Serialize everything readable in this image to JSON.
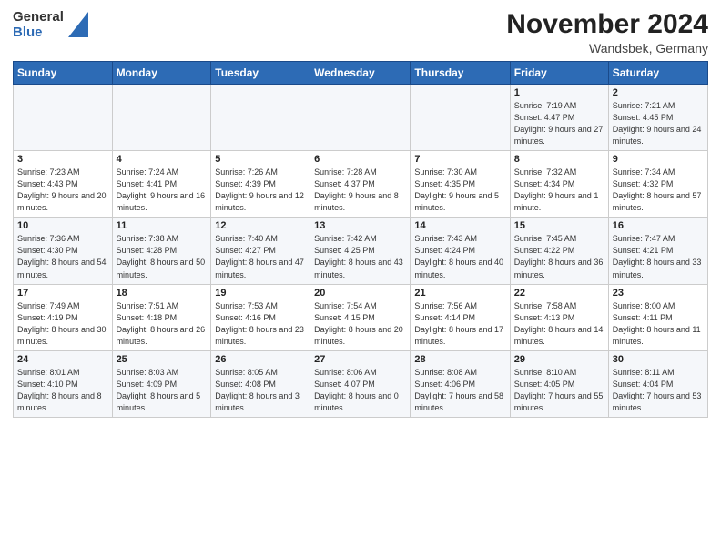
{
  "header": {
    "title": "November 2024",
    "subtitle": "Wandsbek, Germany",
    "logo_general": "General",
    "logo_blue": "Blue"
  },
  "days_of_week": [
    "Sunday",
    "Monday",
    "Tuesday",
    "Wednesday",
    "Thursday",
    "Friday",
    "Saturday"
  ],
  "weeks": [
    {
      "days": [
        {
          "num": "",
          "detail": ""
        },
        {
          "num": "",
          "detail": ""
        },
        {
          "num": "",
          "detail": ""
        },
        {
          "num": "",
          "detail": ""
        },
        {
          "num": "",
          "detail": ""
        },
        {
          "num": "1",
          "detail": "Sunrise: 7:19 AM\nSunset: 4:47 PM\nDaylight: 9 hours\nand 27 minutes."
        },
        {
          "num": "2",
          "detail": "Sunrise: 7:21 AM\nSunset: 4:45 PM\nDaylight: 9 hours\nand 24 minutes."
        }
      ]
    },
    {
      "days": [
        {
          "num": "3",
          "detail": "Sunrise: 7:23 AM\nSunset: 4:43 PM\nDaylight: 9 hours\nand 20 minutes."
        },
        {
          "num": "4",
          "detail": "Sunrise: 7:24 AM\nSunset: 4:41 PM\nDaylight: 9 hours\nand 16 minutes."
        },
        {
          "num": "5",
          "detail": "Sunrise: 7:26 AM\nSunset: 4:39 PM\nDaylight: 9 hours\nand 12 minutes."
        },
        {
          "num": "6",
          "detail": "Sunrise: 7:28 AM\nSunset: 4:37 PM\nDaylight: 9 hours\nand 8 minutes."
        },
        {
          "num": "7",
          "detail": "Sunrise: 7:30 AM\nSunset: 4:35 PM\nDaylight: 9 hours\nand 5 minutes."
        },
        {
          "num": "8",
          "detail": "Sunrise: 7:32 AM\nSunset: 4:34 PM\nDaylight: 9 hours\nand 1 minute."
        },
        {
          "num": "9",
          "detail": "Sunrise: 7:34 AM\nSunset: 4:32 PM\nDaylight: 8 hours\nand 57 minutes."
        }
      ]
    },
    {
      "days": [
        {
          "num": "10",
          "detail": "Sunrise: 7:36 AM\nSunset: 4:30 PM\nDaylight: 8 hours\nand 54 minutes."
        },
        {
          "num": "11",
          "detail": "Sunrise: 7:38 AM\nSunset: 4:28 PM\nDaylight: 8 hours\nand 50 minutes."
        },
        {
          "num": "12",
          "detail": "Sunrise: 7:40 AM\nSunset: 4:27 PM\nDaylight: 8 hours\nand 47 minutes."
        },
        {
          "num": "13",
          "detail": "Sunrise: 7:42 AM\nSunset: 4:25 PM\nDaylight: 8 hours\nand 43 minutes."
        },
        {
          "num": "14",
          "detail": "Sunrise: 7:43 AM\nSunset: 4:24 PM\nDaylight: 8 hours\nand 40 minutes."
        },
        {
          "num": "15",
          "detail": "Sunrise: 7:45 AM\nSunset: 4:22 PM\nDaylight: 8 hours\nand 36 minutes."
        },
        {
          "num": "16",
          "detail": "Sunrise: 7:47 AM\nSunset: 4:21 PM\nDaylight: 8 hours\nand 33 minutes."
        }
      ]
    },
    {
      "days": [
        {
          "num": "17",
          "detail": "Sunrise: 7:49 AM\nSunset: 4:19 PM\nDaylight: 8 hours\nand 30 minutes."
        },
        {
          "num": "18",
          "detail": "Sunrise: 7:51 AM\nSunset: 4:18 PM\nDaylight: 8 hours\nand 26 minutes."
        },
        {
          "num": "19",
          "detail": "Sunrise: 7:53 AM\nSunset: 4:16 PM\nDaylight: 8 hours\nand 23 minutes."
        },
        {
          "num": "20",
          "detail": "Sunrise: 7:54 AM\nSunset: 4:15 PM\nDaylight: 8 hours\nand 20 minutes."
        },
        {
          "num": "21",
          "detail": "Sunrise: 7:56 AM\nSunset: 4:14 PM\nDaylight: 8 hours\nand 17 minutes."
        },
        {
          "num": "22",
          "detail": "Sunrise: 7:58 AM\nSunset: 4:13 PM\nDaylight: 8 hours\nand 14 minutes."
        },
        {
          "num": "23",
          "detail": "Sunrise: 8:00 AM\nSunset: 4:11 PM\nDaylight: 8 hours\nand 11 minutes."
        }
      ]
    },
    {
      "days": [
        {
          "num": "24",
          "detail": "Sunrise: 8:01 AM\nSunset: 4:10 PM\nDaylight: 8 hours\nand 8 minutes."
        },
        {
          "num": "25",
          "detail": "Sunrise: 8:03 AM\nSunset: 4:09 PM\nDaylight: 8 hours\nand 5 minutes."
        },
        {
          "num": "26",
          "detail": "Sunrise: 8:05 AM\nSunset: 4:08 PM\nDaylight: 8 hours\nand 3 minutes."
        },
        {
          "num": "27",
          "detail": "Sunrise: 8:06 AM\nSunset: 4:07 PM\nDaylight: 8 hours\nand 0 minutes."
        },
        {
          "num": "28",
          "detail": "Sunrise: 8:08 AM\nSunset: 4:06 PM\nDaylight: 7 hours\nand 58 minutes."
        },
        {
          "num": "29",
          "detail": "Sunrise: 8:10 AM\nSunset: 4:05 PM\nDaylight: 7 hours\nand 55 minutes."
        },
        {
          "num": "30",
          "detail": "Sunrise: 8:11 AM\nSunset: 4:04 PM\nDaylight: 7 hours\nand 53 minutes."
        }
      ]
    }
  ]
}
